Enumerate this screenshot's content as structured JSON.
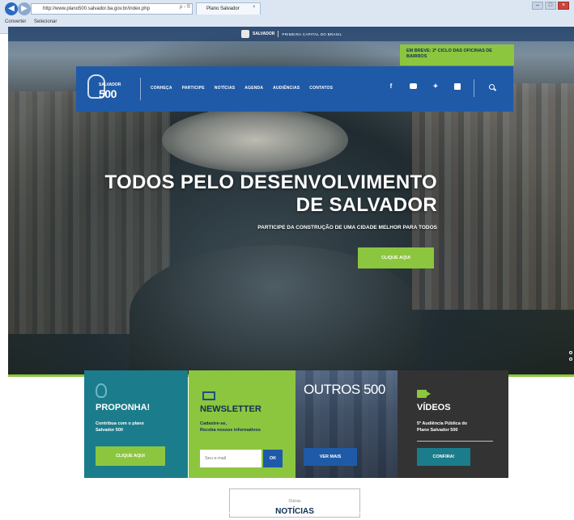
{
  "browser": {
    "address": "http://www.plano500.salvador.ba.gov.br/index.php",
    "address_controls": "ρ - ©",
    "tab_title": "Plano Salvador",
    "favorites": [
      "Converter",
      "Selecionar"
    ]
  },
  "header": {
    "brand": "SALVADOR",
    "tagline": "PRIMEIRA CAPITAL DO BRASIL"
  },
  "announcement": "EM BREVE: 2º CICLO DAS OFICINAS DE BAIRROS",
  "logo": {
    "top": "SALVADOR",
    "number": "500"
  },
  "nav": {
    "items": [
      "CONHEÇA",
      "PARTICIPE",
      "NOTÍCIAS",
      "AGENDA",
      "AUDIÊNCIAS",
      "CONTATOS"
    ],
    "social": [
      "facebook-icon",
      "youtube-icon",
      "twitter-icon",
      "instagram-icon"
    ]
  },
  "hero": {
    "title": "TODOS PELO DESENVOLVIMENTO DE SALVADOR",
    "subtitle": "PARTICIPE DA CONSTRUÇÃO DE UMA CIDADE MELHOR PARA TODOS",
    "button": "CLIQUE AQUI"
  },
  "cards": {
    "proponha": {
      "title": "PROPONHA!",
      "desc_1": "Contribua com o plano",
      "desc_2": "Salvador 500",
      "button": "CLIQUE AQUI"
    },
    "newsletter": {
      "title": "NEWSLETTER",
      "desc_1": "Cadastre-se,",
      "desc_2": "Receba nossos informativos",
      "placeholder": "Seu e-mail",
      "button": "OK"
    },
    "outros": {
      "title": "OUTROS 500",
      "button": "VER MAIS"
    },
    "videos": {
      "title": "VÍDEOS",
      "desc_1": "5ª Audiência Pública do",
      "desc_2": "Plano Salvador 500",
      "button": "CONFIRA!"
    }
  },
  "news": {
    "small": "Outras",
    "big": "NOTÍCIAS"
  },
  "colors": {
    "primary_blue": "#1e5aa8",
    "accent_green": "#8cc63f",
    "teal": "#1b7c8c"
  }
}
